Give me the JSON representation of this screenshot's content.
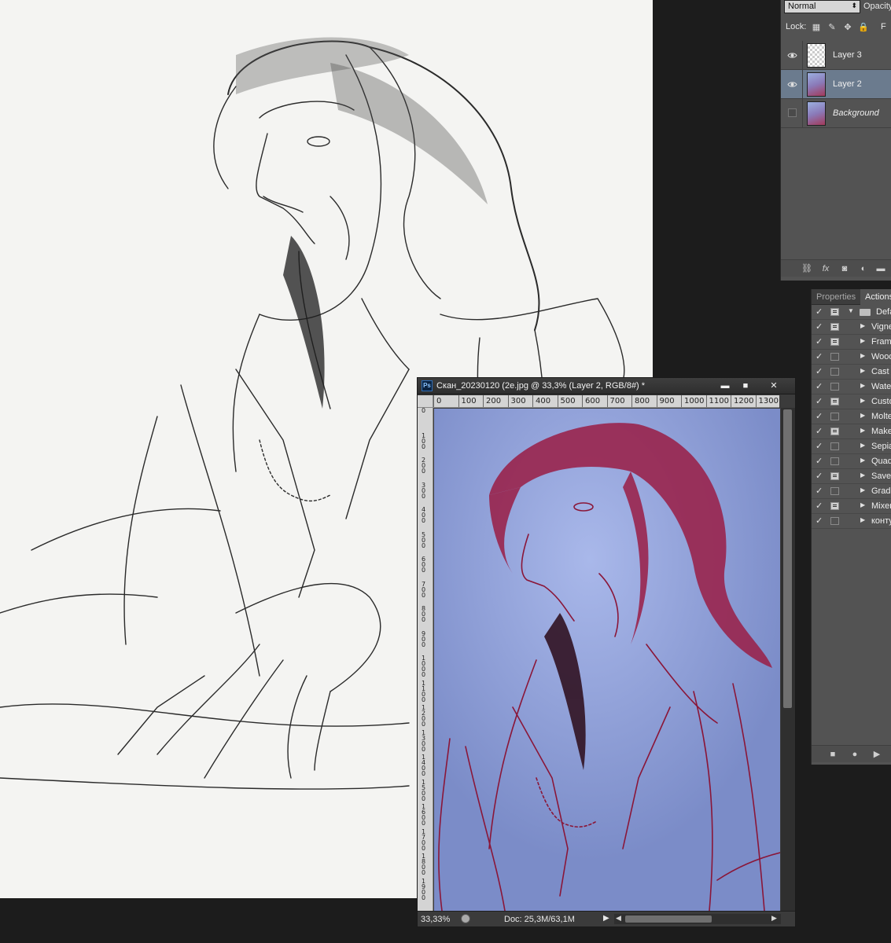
{
  "layers_panel": {
    "blend_mode": "Normal",
    "opacity_label": "Opacity",
    "lock_label": "Lock:",
    "fill_label": "F",
    "layers": [
      {
        "name": "Layer 3",
        "visible": true,
        "selected": false,
        "thumb": "transparent"
      },
      {
        "name": "Layer 2",
        "visible": true,
        "selected": true,
        "thumb": "art"
      },
      {
        "name": "Background",
        "visible": false,
        "selected": false,
        "thumb": "art"
      }
    ],
    "bottom_icons": [
      "link-icon",
      "fx-icon",
      "mask-icon",
      "adjustment-icon",
      "folder-icon"
    ]
  },
  "actions_panel": {
    "tabs": [
      "Properties",
      "Actions"
    ],
    "active_tab": "Actions",
    "folder": {
      "label": "Defa",
      "checked": true,
      "dialog": true
    },
    "actions": [
      {
        "label": "Vigne",
        "checked": true,
        "dialog": true
      },
      {
        "label": "Frame",
        "checked": true,
        "dialog": true
      },
      {
        "label": "Wood",
        "checked": true,
        "dialog": false
      },
      {
        "label": "Cast",
        "checked": true,
        "dialog": false
      },
      {
        "label": "Wate",
        "checked": true,
        "dialog": false
      },
      {
        "label": "Custo",
        "checked": true,
        "dialog": true
      },
      {
        "label": "Molte",
        "checked": true,
        "dialog": false
      },
      {
        "label": "Make",
        "checked": true,
        "dialog": true
      },
      {
        "label": "Sepia",
        "checked": true,
        "dialog": false
      },
      {
        "label": "Quad",
        "checked": true,
        "dialog": false
      },
      {
        "label": "Save",
        "checked": true,
        "dialog": true
      },
      {
        "label": "Gradi",
        "checked": true,
        "dialog": false
      },
      {
        "label": "Mixer",
        "checked": true,
        "dialog": true
      },
      {
        "label": "конту",
        "checked": true,
        "dialog": false
      }
    ],
    "controls": [
      "stop-icon",
      "record-icon",
      "play-icon"
    ]
  },
  "document": {
    "app_icon": "Ps",
    "title": "Скан_20230120 (2е.jpg @ 33,3% (Layer 2, RGB/8#) *",
    "window_buttons": {
      "minimize": "▬",
      "maximize": "■",
      "close": "✕"
    },
    "ruler_h": [
      "0",
      "100",
      "200",
      "300",
      "400",
      "500",
      "600",
      "700",
      "800",
      "900",
      "1000",
      "1100",
      "1200",
      "1300"
    ],
    "ruler_v": [
      "0",
      "1 0 0",
      "2 0 0",
      "3 0 0",
      "4 0 0",
      "5 0 0",
      "6 0 0",
      "7 0 0",
      "8 0 0",
      "9 0 0",
      "1 0 0 0",
      "1 1 0 0",
      "1 2 0 0",
      "1 3 0 0",
      "1 4 0 0",
      "1 5 0 0",
      "1 6 0 0",
      "1 7 0 0",
      "1 8 0 0",
      "1 9 0 0"
    ],
    "zoom": "33,33%",
    "doc_size": "Doc: 25,3M/63,1M"
  },
  "colors": {
    "canvas_bg": "#8d9ed6",
    "sketch_ink": "#a0183a",
    "selected_layer": "#6b7b8e",
    "paper": "#f4f4f2"
  }
}
